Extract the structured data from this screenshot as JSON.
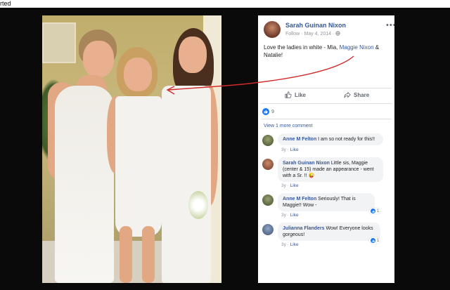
{
  "window": {
    "title_fragment": "rted"
  },
  "post": {
    "author": "Sarah Guinan Nixon",
    "follow_label": "Follow",
    "separator": "·",
    "date": "May 4, 2014",
    "privacy_sep": "·",
    "more_icon": "ellipsis-icon",
    "caption_before": "Love the ladies in white - Mia, ",
    "caption_link": "Maggie Nixon",
    "caption_after": " & Natalie!"
  },
  "actions": {
    "like_label": "Like",
    "share_label": "Share"
  },
  "reactions": {
    "count": "9"
  },
  "view_more": "View 1 more comment",
  "comments": [
    {
      "name": "Anne M Felton",
      "text": " I am so not ready for this!!",
      "age": "3y",
      "dot": " · ",
      "like": "Like",
      "reacts": ""
    },
    {
      "name": "Sarah Guinan Nixon",
      "text": " Little sis, Maggie (center & 15) made an appearance - went with a Sr. !! 😜",
      "age": "3y",
      "dot": " · ",
      "like": "Like",
      "reacts": ""
    },
    {
      "name": "Anne M Felton",
      "text": " Seriously! That is Maggie!! Wow -",
      "age": "3y",
      "dot": " · ",
      "like": "Like",
      "reacts": "1"
    },
    {
      "name": "Julianna Flanders",
      "text": " Wow! Everyone looks gorgeous!",
      "age": "3y",
      "dot": " · ",
      "like": "Like",
      "reacts": "1"
    }
  ],
  "colors": {
    "link": "#385898",
    "like_blue": "#1877f2",
    "annotation_arrow": "#d22b2b"
  }
}
